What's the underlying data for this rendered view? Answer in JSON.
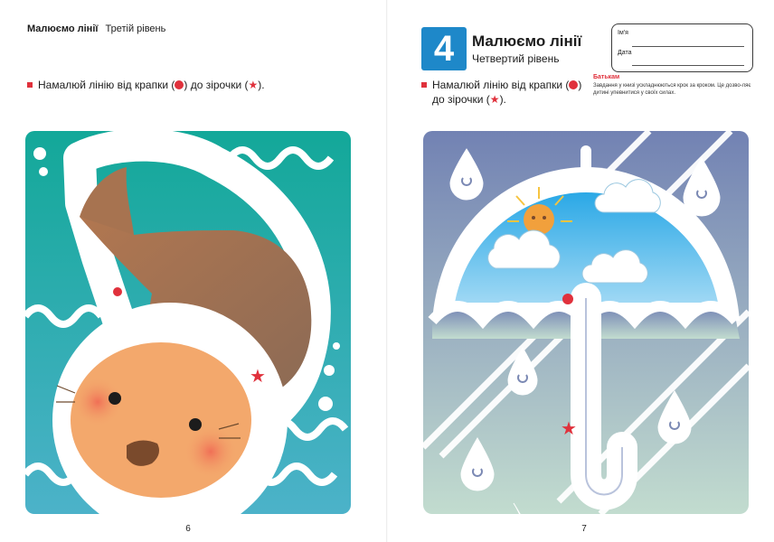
{
  "left_page": {
    "running_head_title": "Малюємо лінії",
    "running_head_level": "Третій рівень",
    "instruction_before_dot": "Намалюй лінію від крапки (",
    "instruction_between": ") до зірочки (",
    "instruction_after_star": ").",
    "page_number": "6",
    "illustration": "seal"
  },
  "right_page": {
    "badge_number": "4",
    "title": "Малюємо лінії",
    "level": "Четвертий рівень",
    "form": {
      "name_label": "Ім'я",
      "date_label": "Дата"
    },
    "instruction_line1_before_dot": "Намалюй лінію від крапки (",
    "instruction_line1_after_dot": ")",
    "instruction_line2_before_star": "до зірочки (",
    "instruction_line2_after_star": ").",
    "parents_title": "Батькам",
    "parents_note": "Завдання у книзі ускладнюються крок за кроком. Це дозво-ляє дитині упевнитися у своїх силах.",
    "page_number": "7",
    "illustration": "umbrella"
  },
  "colors": {
    "accent_red": "#e0313c",
    "badge_blue": "#1e88c9",
    "seal_sea_top": "#17a89b",
    "seal_sea_bottom": "#48b3c7",
    "seal_body_brown": "#a77350",
    "seal_face_orange": "#f3a86c",
    "umbrella_sky_top": "#7686b4",
    "umbrella_sky_bottom": "#bfd9cc",
    "umbrella_canopy_blue": "#3eb0e8",
    "sun_orange": "#f1a03c"
  },
  "icons": {
    "dot": "red-dot-icon",
    "star": "red-star-icon"
  }
}
